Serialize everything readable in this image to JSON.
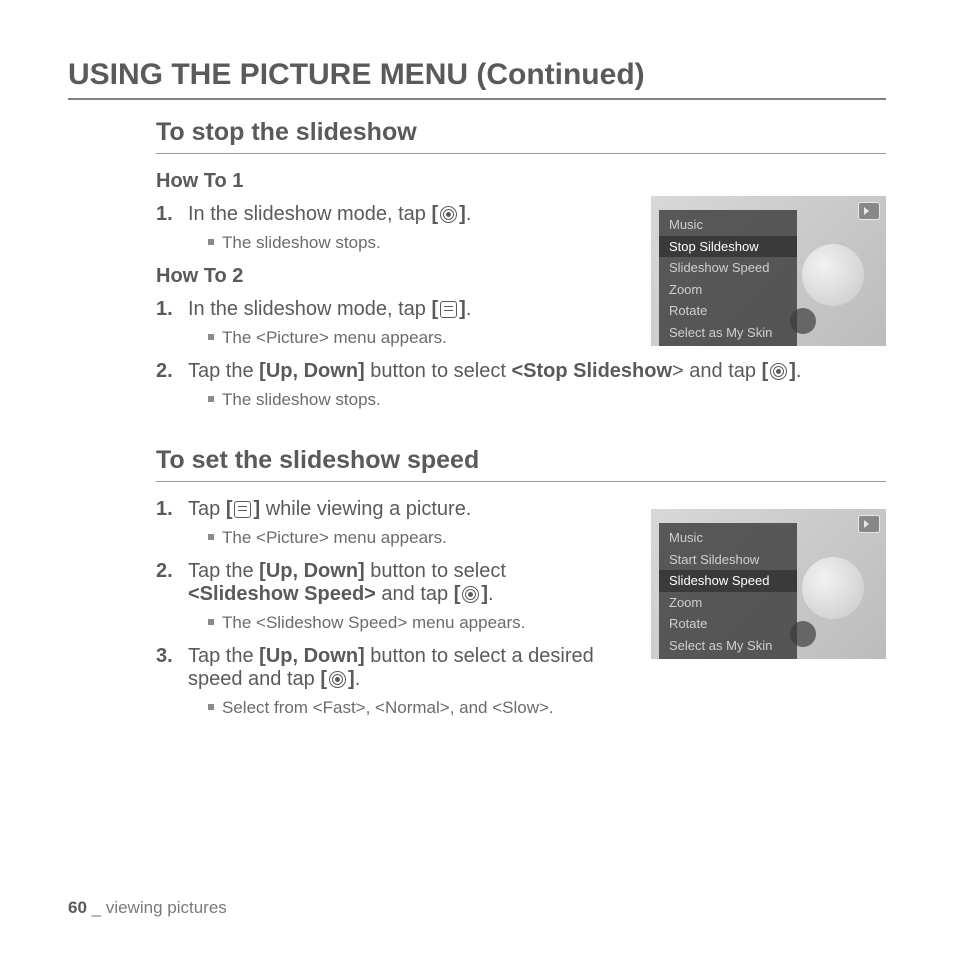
{
  "title": "USING THE PICTURE MENU (Continued)",
  "section1": {
    "heading": "To stop the slideshow",
    "howto1": {
      "label": "How To 1",
      "step1_a": "In the slideshow mode, tap ",
      "step1_c": ".",
      "sub1": "The slideshow stops."
    },
    "howto2": {
      "label": "How To 2",
      "step1_a": "In the slideshow mode, tap ",
      "step1_c": ".",
      "sub1": "The <Picture> menu appears.",
      "step2_a": "Tap the ",
      "step2_b": "[Up, Down]",
      "step2_c": " button to select ",
      "step2_d": "<Stop Slideshow",
      "step2_e": "> and tap ",
      "step2_g": ".",
      "sub2": "The slideshow stops."
    },
    "menu": {
      "items": [
        "Music",
        "Stop Sildeshow",
        "Slideshow Speed",
        "Zoom",
        "Rotate",
        "Select as My Skin"
      ],
      "selectedIndex": 1
    }
  },
  "section2": {
    "heading": "To set the slideshow speed",
    "step1_a": "Tap ",
    "step1_c": " while viewing a picture.",
    "sub1": "The <Picture> menu appears.",
    "step2_a": "Tap the ",
    "step2_b": "[Up, Down]",
    "step2_c": " button to select ",
    "step2_d": "<Slideshow Speed>",
    "step2_e": " and tap ",
    "step2_g": ".",
    "sub2": "The <Slideshow Speed> menu appears.",
    "step3_a": "Tap the ",
    "step3_b": "[Up, Down]",
    "step3_c": " button to select a desired speed and tap ",
    "step3_e": ".",
    "sub3": "Select from <Fast>, <Normal>, and <Slow>.",
    "menu": {
      "items": [
        "Music",
        "Start Sildeshow",
        "Slideshow Speed",
        "Zoom",
        "Rotate",
        "Select as My Skin"
      ],
      "selectedIndex": 2
    }
  },
  "icons": {
    "bracketL": "[",
    "bracketR": "]"
  },
  "footer": {
    "page": "60",
    "sep": " _ ",
    "chapter": "viewing pictures"
  }
}
